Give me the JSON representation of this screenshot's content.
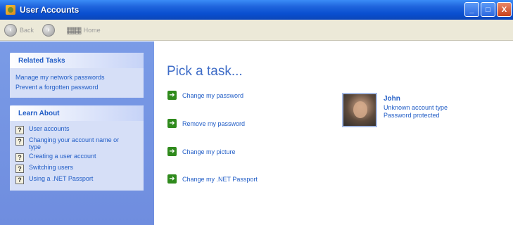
{
  "window": {
    "title": "User Accounts",
    "buttons": {
      "minimize": "_",
      "maximize": "□",
      "close": "X"
    }
  },
  "toolbar": {
    "back_label": "Back",
    "home_label": "Home",
    "back_icon": "back-arrow-icon",
    "forward_icon": "forward-arrow-icon",
    "home_icon": "home-icon"
  },
  "sidebar": {
    "related_tasks": {
      "heading": "Related Tasks",
      "links": [
        "Manage my network passwords",
        "Prevent a forgotten password"
      ]
    },
    "learn_about": {
      "heading": "Learn About",
      "items": [
        "User accounts",
        "Changing your account name or type",
        "Creating a user account",
        "Switching users",
        "Using a .NET Passport"
      ]
    }
  },
  "main": {
    "title": "Pick a task...",
    "tasks": [
      "Change my password",
      "Remove my password",
      "Change my picture",
      "Change my .NET Passport"
    ]
  },
  "user": {
    "name": "John",
    "account_type": "Unknown account type",
    "status": "Password protected"
  },
  "colors": {
    "title_bar": "#0a4fd0",
    "sidebar": "#6f8ddf",
    "link": "#215dc6",
    "task_arrow": "#2f8a1c"
  }
}
